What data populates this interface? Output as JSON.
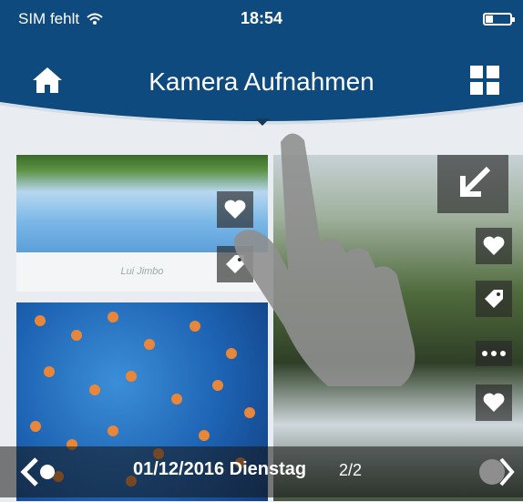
{
  "status_bar": {
    "carrier": "SIM fehlt",
    "time": "18:54"
  },
  "header": {
    "title": "Kamera Aufnahmen"
  },
  "gallery": {
    "caption": "Lui Jimbo"
  },
  "bottom_bar": {
    "date": "01/12/2016 Dienstag",
    "page": "2/2"
  },
  "icons": {
    "home": "home-icon",
    "grid": "grid-icon",
    "heart": "heart-icon",
    "tag": "tag-icon",
    "more": "more-icon",
    "expand": "expand-arrow-icon",
    "back": "back-arrow-icon",
    "next": "next-arrow-icon",
    "wifi": "wifi-icon",
    "battery": "battery-icon"
  },
  "colors": {
    "primary": "#0e4a7d",
    "background": "#e9edf1",
    "accent_orange": "#e8873a"
  }
}
